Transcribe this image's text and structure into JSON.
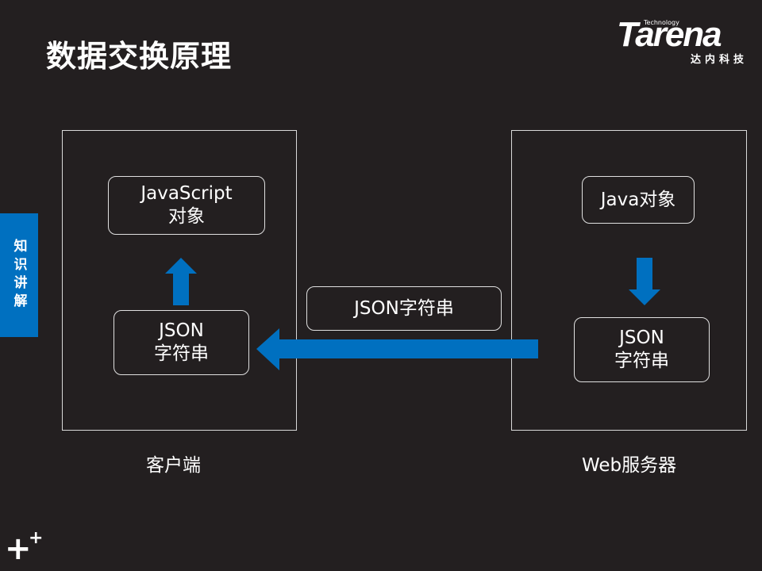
{
  "title": "数据交换原理",
  "logo": {
    "brand": "Tarena",
    "tagline": "Technology",
    "cn": "达内科技"
  },
  "side_tab": "知识讲解",
  "client": {
    "label": "客户端",
    "top_box": "JavaScript\n对象",
    "bottom_box": "JSON\n字符串"
  },
  "server": {
    "label": "Web服务器",
    "top_box": "Java对象",
    "bottom_box": "JSON\n字符串"
  },
  "transfer_label": "JSON字符串",
  "colors": {
    "background": "#231f20",
    "accent": "#0070c0"
  }
}
